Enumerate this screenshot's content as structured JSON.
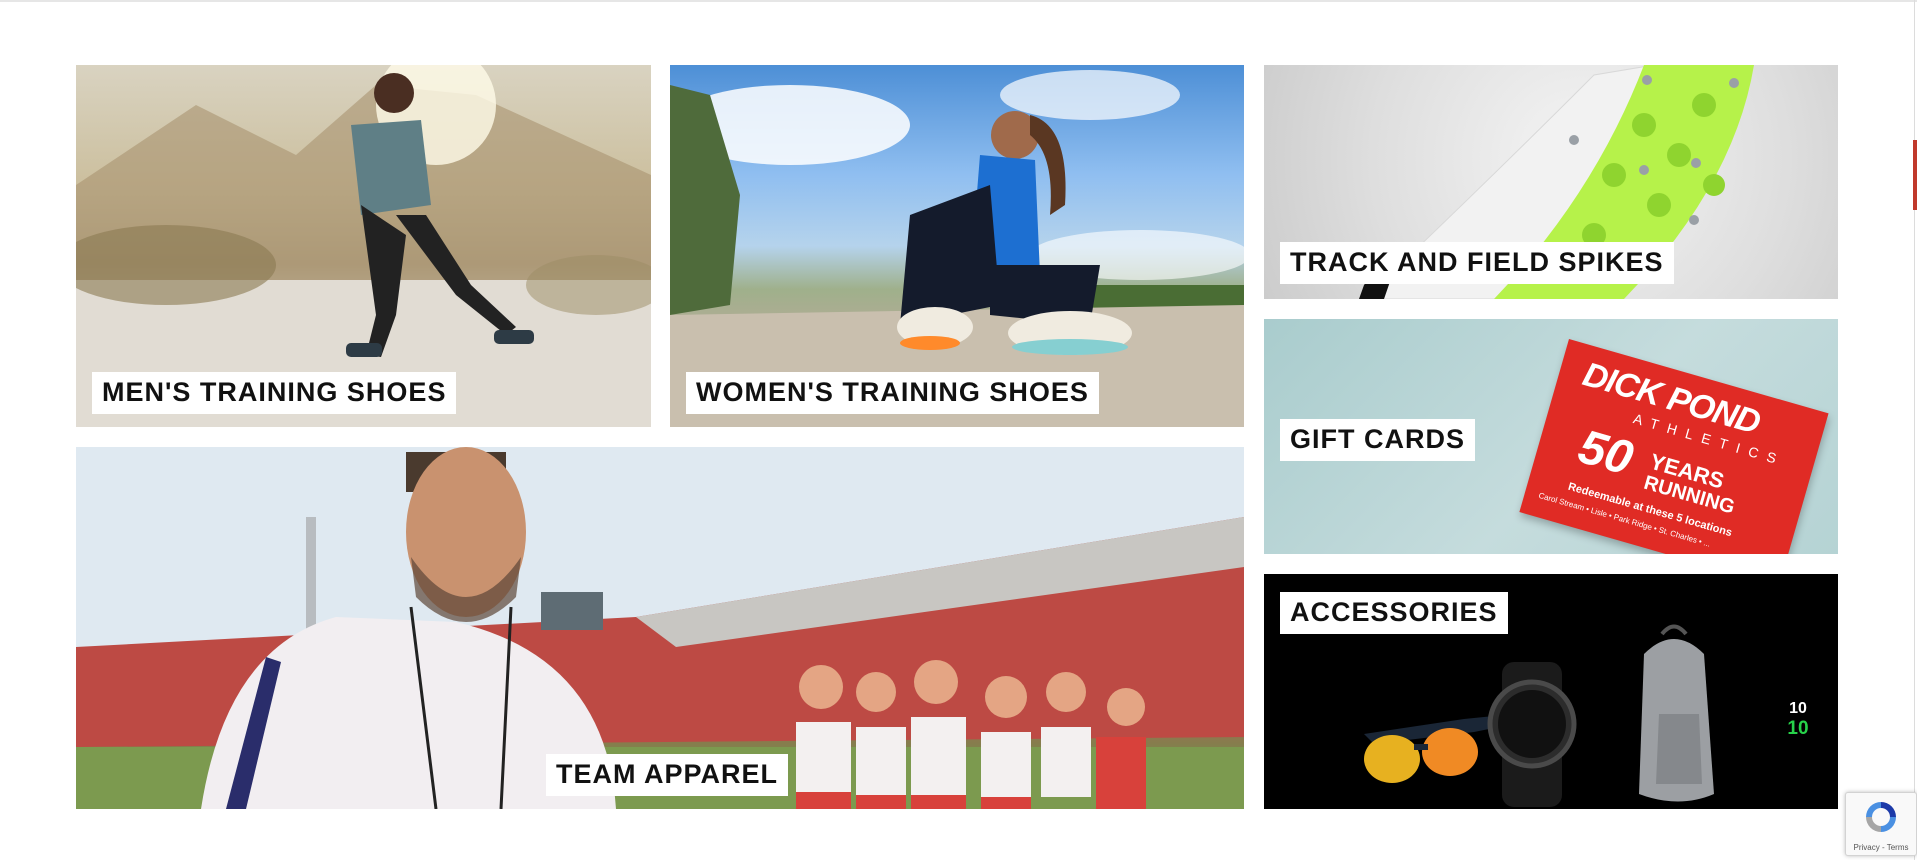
{
  "tiles": {
    "mens_training": {
      "label": "MEN'S TRAINING SHOES"
    },
    "womens_training": {
      "label": "WOMEN'S TRAINING SHOES"
    },
    "track_field": {
      "label": "TRACK AND FIELD SPIKES"
    },
    "gift_cards": {
      "label": "GIFT CARDS",
      "card_brand": "DICK POND",
      "card_brand_sub": "ATHLETICS",
      "card_years": "50",
      "card_years_text": "YEARS",
      "card_running": "RUNNING",
      "card_redeem": "Redeemable at these 5 locations",
      "card_locations": "Carol Stream • Lisle • Park Ridge • St. Charles • ..."
    },
    "team_apparel": {
      "label": "TEAM APPAREL"
    },
    "accessories": {
      "label": "ACCESSORIES",
      "watch_time": "10",
      "watch_time2": "10"
    }
  },
  "recaptcha": {
    "links": "Privacy - Terms"
  },
  "colors": {
    "accent_red": "#c0392b",
    "spike_green": "#b6f24a",
    "gift_card_red": "#e02b25",
    "label_bg": "#ffffff",
    "label_text": "#111111"
  }
}
